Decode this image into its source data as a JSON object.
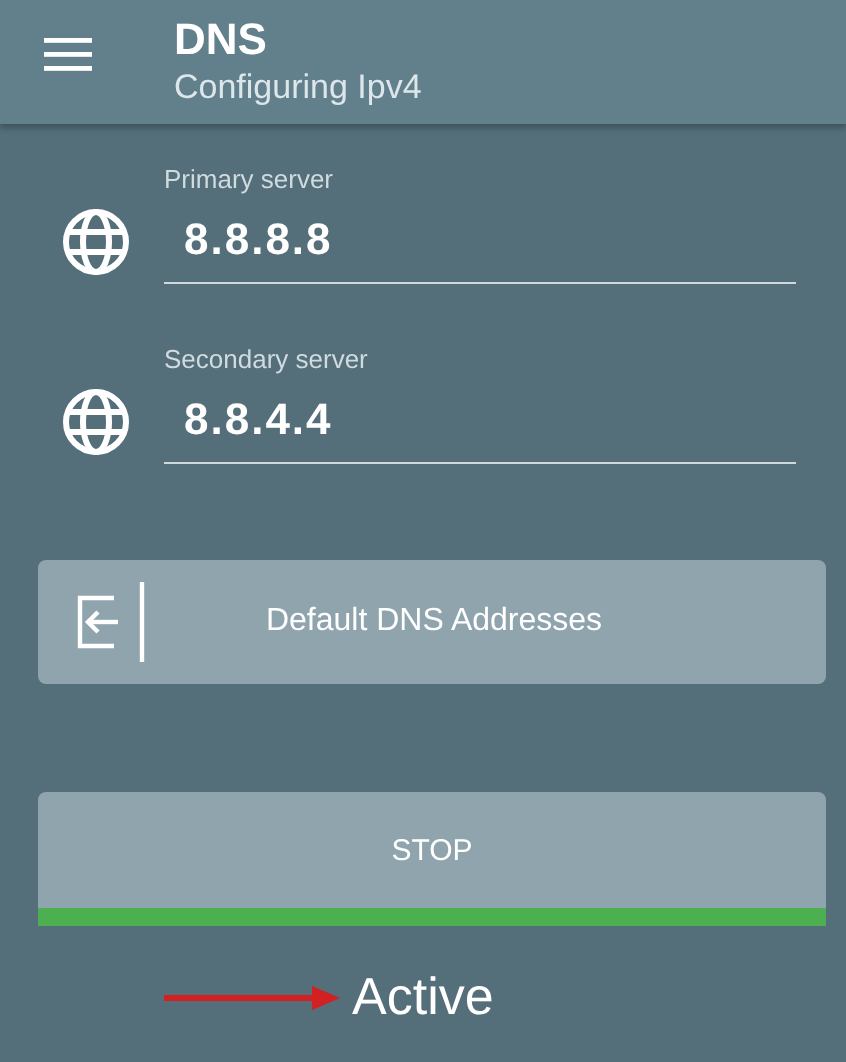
{
  "header": {
    "title": "DNS",
    "subtitle": "Configuring Ipv4"
  },
  "servers": [
    {
      "label": "Primary server",
      "value": "8.8.8.8"
    },
    {
      "label": "Secondary server",
      "value": "8.8.4.4"
    }
  ],
  "default_button": {
    "label": "Default DNS Addresses"
  },
  "stop_button": {
    "label": "STOP"
  },
  "status": {
    "active": true,
    "label": "Active"
  }
}
